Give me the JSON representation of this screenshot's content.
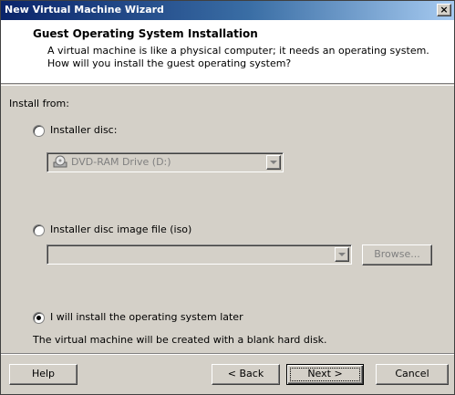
{
  "window": {
    "title": "New Virtual Machine Wizard",
    "close_glyph": "×"
  },
  "header": {
    "title": "Guest Operating System Installation",
    "description": "A virtual machine is like a physical computer; it needs an operating system. How will you install the guest operating system?"
  },
  "body": {
    "install_from_label": "Install from:",
    "options": [
      {
        "label": "Installer disc:",
        "selected": false
      },
      {
        "label": "Installer disc image file (iso)",
        "selected": false
      },
      {
        "label": "I will install the operating system later",
        "selected": true
      }
    ],
    "disc_drive": {
      "value": "DVD-RAM Drive (D:)",
      "icon": "cd-drive-icon"
    },
    "iso_path": {
      "value": ""
    },
    "browse_label": "Browse...",
    "later_note": "The virtual machine will be created with a blank hard disk."
  },
  "footer": {
    "help_label": "Help",
    "back_label": "< Back",
    "next_label": "Next >",
    "cancel_label": "Cancel"
  },
  "colors": {
    "title_bar_start": "#0a246a",
    "title_bar_end": "#a6caf0",
    "dialog_face": "#d4d0c8",
    "disabled_text": "#808080"
  }
}
